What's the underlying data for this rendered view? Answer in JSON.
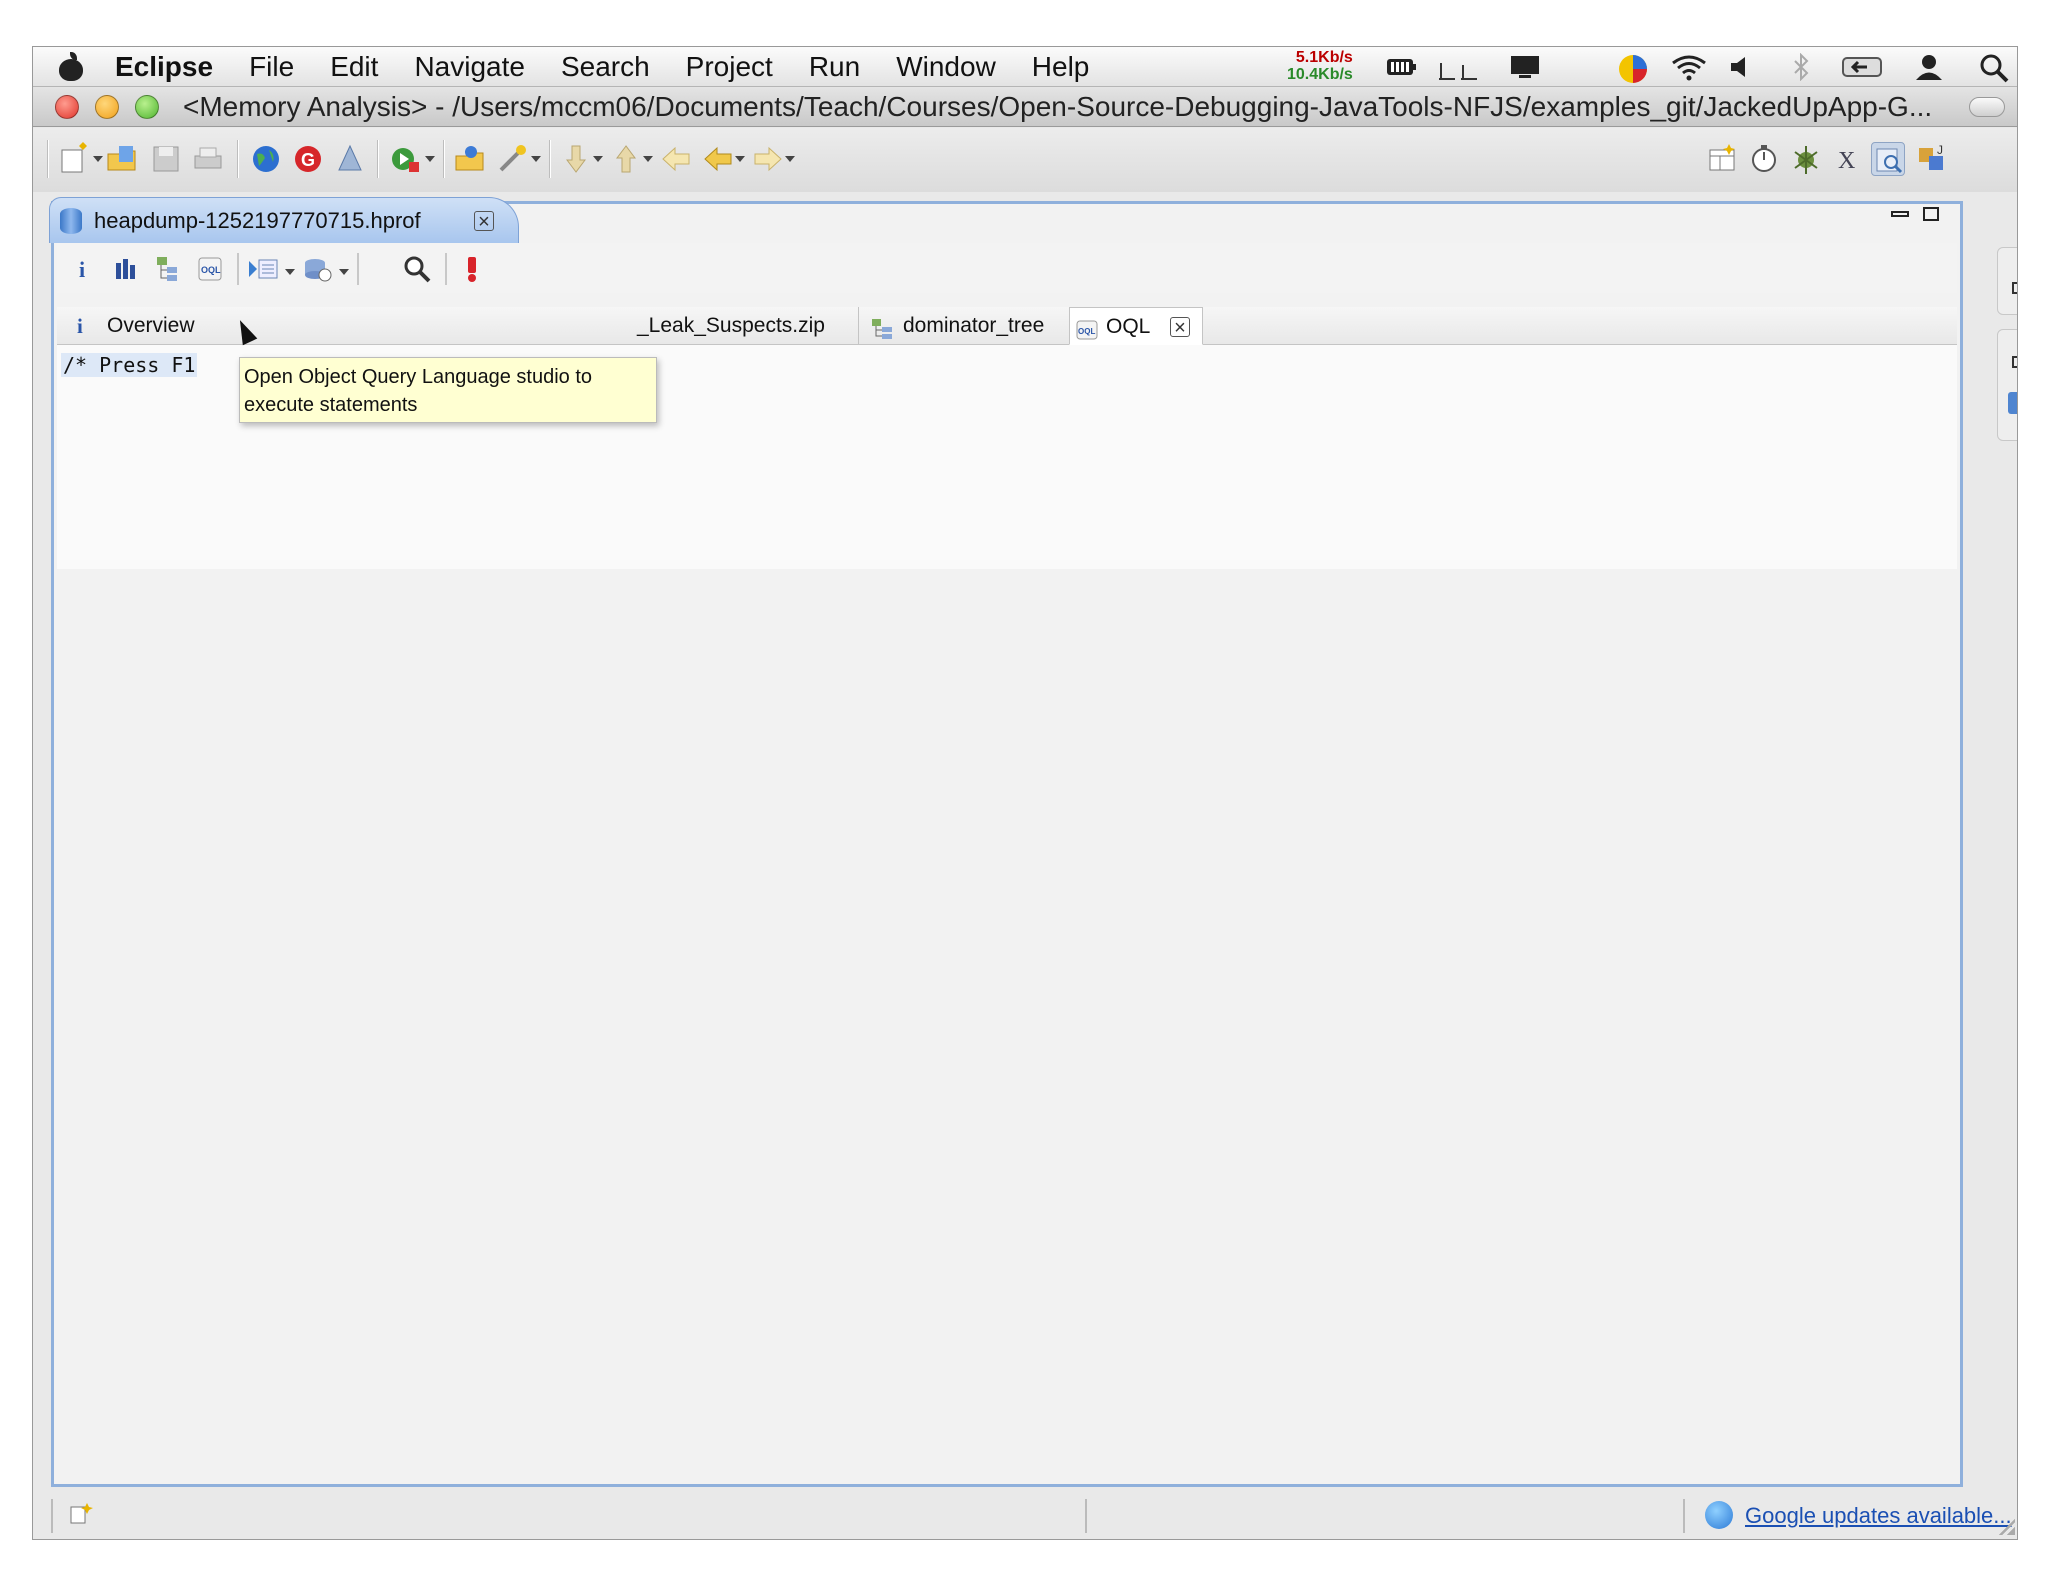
{
  "menubar": {
    "app": "Eclipse",
    "items": [
      "File",
      "Edit",
      "Navigate",
      "Search",
      "Project",
      "Run",
      "Window",
      "Help"
    ],
    "net_up": "5.1Kb/s",
    "net_down": "10.4Kb/s"
  },
  "window": {
    "title": "<Memory Analysis> - /Users/mccm06/Documents/Teach/Courses/Open-Source-Debugging-JavaTools-NFJS/examples_git/JackedUpApp-G..."
  },
  "editor_tab": {
    "label": "heapdump-1252197770715.hprof"
  },
  "inner_tabs": [
    {
      "label": "Overview",
      "icon": "info-icon"
    },
    {
      "label": "_Leak_Suspects.zip",
      "icon": "report-icon"
    },
    {
      "label": "dominator_tree",
      "icon": "tree-icon"
    },
    {
      "label": "OQL",
      "icon": "oql-icon"
    }
  ],
  "oql": {
    "code": "/* Press F1"
  },
  "tooltip": {
    "line1": "Open Object Query Language studio to",
    "line2": "execute statements"
  },
  "status": {
    "google_updates": "Google updates available..."
  },
  "colors": {
    "accent_border": "#8fb0dc",
    "tooltip_bg": "#ffffd2",
    "link": "#1a4fb3"
  }
}
